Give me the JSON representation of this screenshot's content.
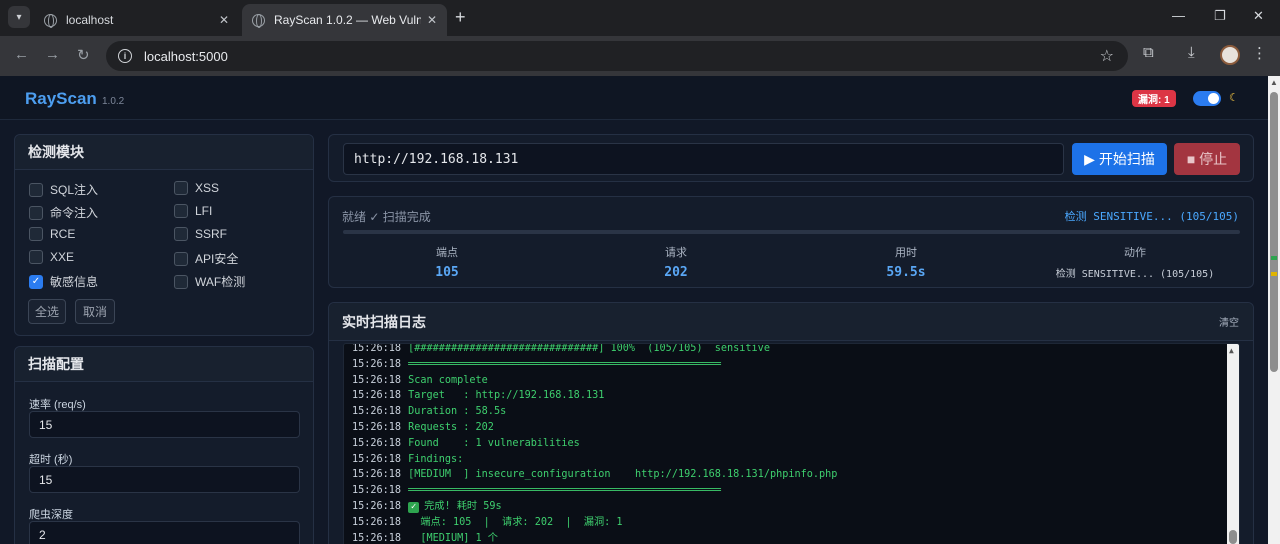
{
  "browser": {
    "tabs": [
      {
        "label": "localhost",
        "active": false
      },
      {
        "label": "RayScan 1.0.2 — Web Vulnerability Scanner",
        "active": true
      }
    ],
    "url": "localhost:5000"
  },
  "header": {
    "brand": "RayScan",
    "version": "1.0.2",
    "vuln_badge": "漏洞: 1",
    "theme_icon": "moon-icon",
    "accent": "#4d9ef0"
  },
  "modules": {
    "title": "检测模块",
    "items": [
      {
        "label": "SQL注入",
        "checked": false
      },
      {
        "label": "XSS",
        "checked": false
      },
      {
        "label": "命令注入",
        "checked": false
      },
      {
        "label": "LFI",
        "checked": false
      },
      {
        "label": "RCE",
        "checked": false
      },
      {
        "label": "SSRF",
        "checked": false
      },
      {
        "label": "XXE",
        "checked": false
      },
      {
        "label": "API安全",
        "checked": false
      },
      {
        "label": "敏感信息",
        "checked": true
      },
      {
        "label": "WAF检测",
        "checked": false
      }
    ],
    "select_all": "全选",
    "deselect": "取消"
  },
  "config": {
    "title": "扫描配置",
    "rate_label": "速率 (req/s)",
    "rate_value": "15",
    "timeout_label": "超时 (秒)",
    "timeout_value": "15",
    "depth_label": "爬虫深度",
    "depth_value": "2"
  },
  "scan": {
    "target": "http://192.168.18.131",
    "start_label": "▶ 开始扫描",
    "stop_label": "■ 停止"
  },
  "status": {
    "text": "就绪 ✓ 扫描完成",
    "current": "检测 SENSITIVE... (105/105)",
    "progress_percent": 100,
    "stats": [
      {
        "label": "端点",
        "value": "105"
      },
      {
        "label": "请求",
        "value": "202"
      },
      {
        "label": "用时",
        "value": "59.5s"
      },
      {
        "label": "动作",
        "value": "检测 SENSITIVE... (105/105)"
      }
    ]
  },
  "log": {
    "title": "实时扫描日志",
    "clear": "清空",
    "lines": [
      {
        "ts": "15:26:18",
        "msg": "[##############################] 100%  (105/105)  sensitive"
      },
      {
        "ts": "15:26:18",
        "msg": "═══════════════════════════════════════════════════"
      },
      {
        "ts": "15:26:18",
        "msg": "Scan complete"
      },
      {
        "ts": "15:26:18",
        "msg": "Target   : http://192.168.18.131"
      },
      {
        "ts": "15:26:18",
        "msg": "Duration : 58.5s"
      },
      {
        "ts": "15:26:18",
        "msg": "Requests : 202"
      },
      {
        "ts": "15:26:18",
        "msg": "Found    : 1 vulnerabilities"
      },
      {
        "ts": "15:26:18",
        "msg": "Findings:"
      },
      {
        "ts": "15:26:18",
        "msg": "[MEDIUM  ] insecure_configuration    http://192.168.18.131/phpinfo.php"
      },
      {
        "ts": "15:26:18",
        "msg": "═══════════════════════════════════════════════════"
      },
      {
        "ts": "15:26:18",
        "msg": "完成! 耗时 59s"
      },
      {
        "ts": "15:26:18",
        "msg": "  端点: 105  |  请求: 202  |  漏洞: 1"
      },
      {
        "ts": "15:26:18",
        "msg": "  [MEDIUM] 1 个"
      }
    ]
  }
}
